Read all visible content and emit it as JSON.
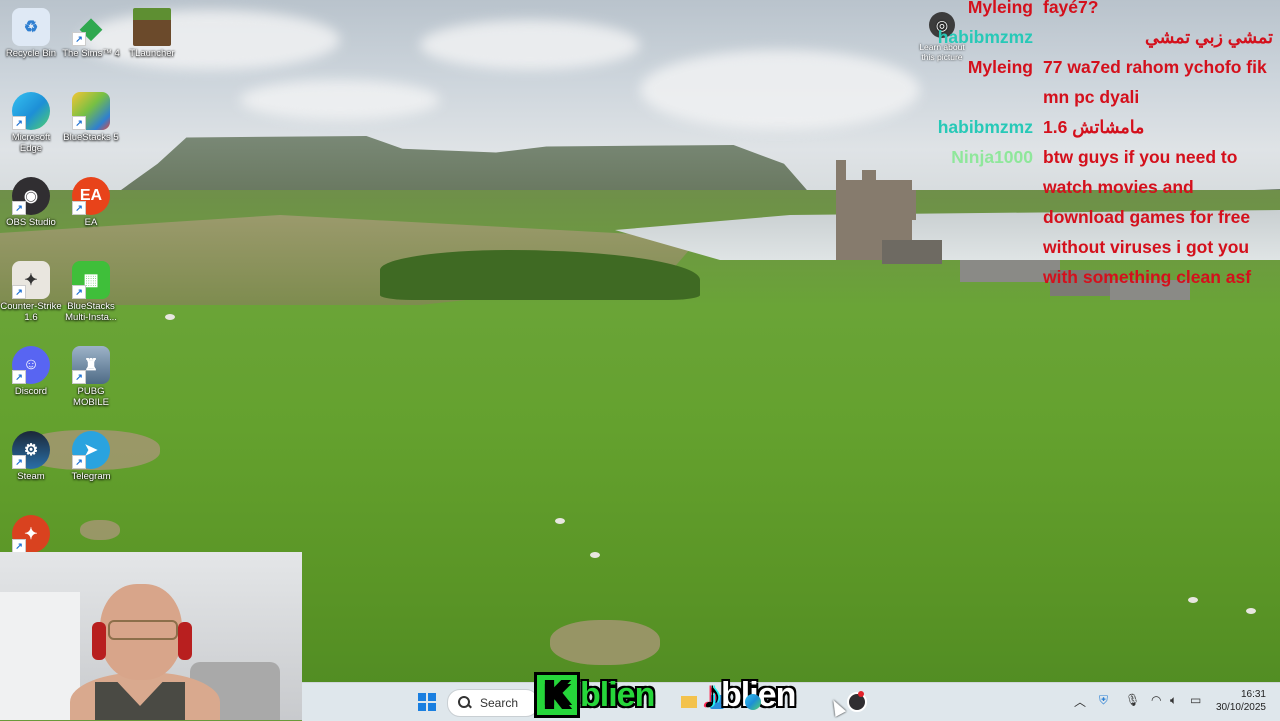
{
  "desktop_icons": [
    {
      "label": "Recycle Bin",
      "icon": "recycle-bin-icon",
      "color": "#dfe9f5"
    },
    {
      "label": "The Sims™ 4",
      "icon": "sims-icon",
      "color": "#2fa84f"
    },
    {
      "label": "TLauncher",
      "icon": "tlauncher-icon",
      "color": "#5e8f32"
    },
    {
      "label": "Microsoft Edge",
      "icon": "edge-icon",
      "color": "#1d8fd6"
    },
    {
      "label": "BlueStacks 5",
      "icon": "bluestacks-icon",
      "color": "#77c043"
    },
    {
      "label": "OBS Studio",
      "icon": "obs-icon",
      "color": "#302e31"
    },
    {
      "label": "EA",
      "icon": "ea-icon",
      "color": "#e8431a"
    },
    {
      "label": "Counter-Strike 1.6",
      "icon": "counter-strike-icon",
      "color": "#e9e6df"
    },
    {
      "label": "BlueStacks Multi-Insta...",
      "icon": "bluestacks-multi-icon",
      "color": "#3fbf3a"
    },
    {
      "label": "Discord",
      "icon": "discord-icon",
      "color": "#5865f2"
    },
    {
      "label": "PUBG MOBILE",
      "icon": "pubg-icon",
      "color": "#6d8aa6"
    },
    {
      "label": "Steam",
      "icon": "steam-icon",
      "color": "#1b2838"
    },
    {
      "label": "Telegram",
      "icon": "telegram-icon",
      "color": "#2aa3df"
    },
    {
      "label": "",
      "icon": "counter-strike-2-icon",
      "color": "#d9421f"
    }
  ],
  "learn_about": {
    "label_line1": "Learn about",
    "label_line2": "this picture"
  },
  "chat": [
    {
      "user": "Myleing",
      "user_color": "#d4101c",
      "message": "fayé7?"
    },
    {
      "user": "habibmzmz",
      "user_color": "#27c9b7",
      "message": "تمشي زبي تمشي"
    },
    {
      "user": "Myleing",
      "user_color": "#d4101c",
      "message": "77 wa7ed rahom ychofo fik mn pc dyali"
    },
    {
      "user": "habibmzmz",
      "user_color": "#27c9b7",
      "message": "1.6 مامشاتش"
    },
    {
      "user": "Ninja1000",
      "user_color": "#8fe79b",
      "message": "btw guys if you need to watch movies and download games for free without viruses i got you with something clean asf"
    }
  ],
  "taskbar": {
    "search_label": "Search",
    "overlay_text": "blien",
    "overlay_k": "K",
    "time": "16:31",
    "date": "30/10/2025"
  },
  "colors": {
    "chat_message": "#d4101c",
    "overlay_green": "#26d63a",
    "taskbar_bg": "#dfe7ec"
  }
}
